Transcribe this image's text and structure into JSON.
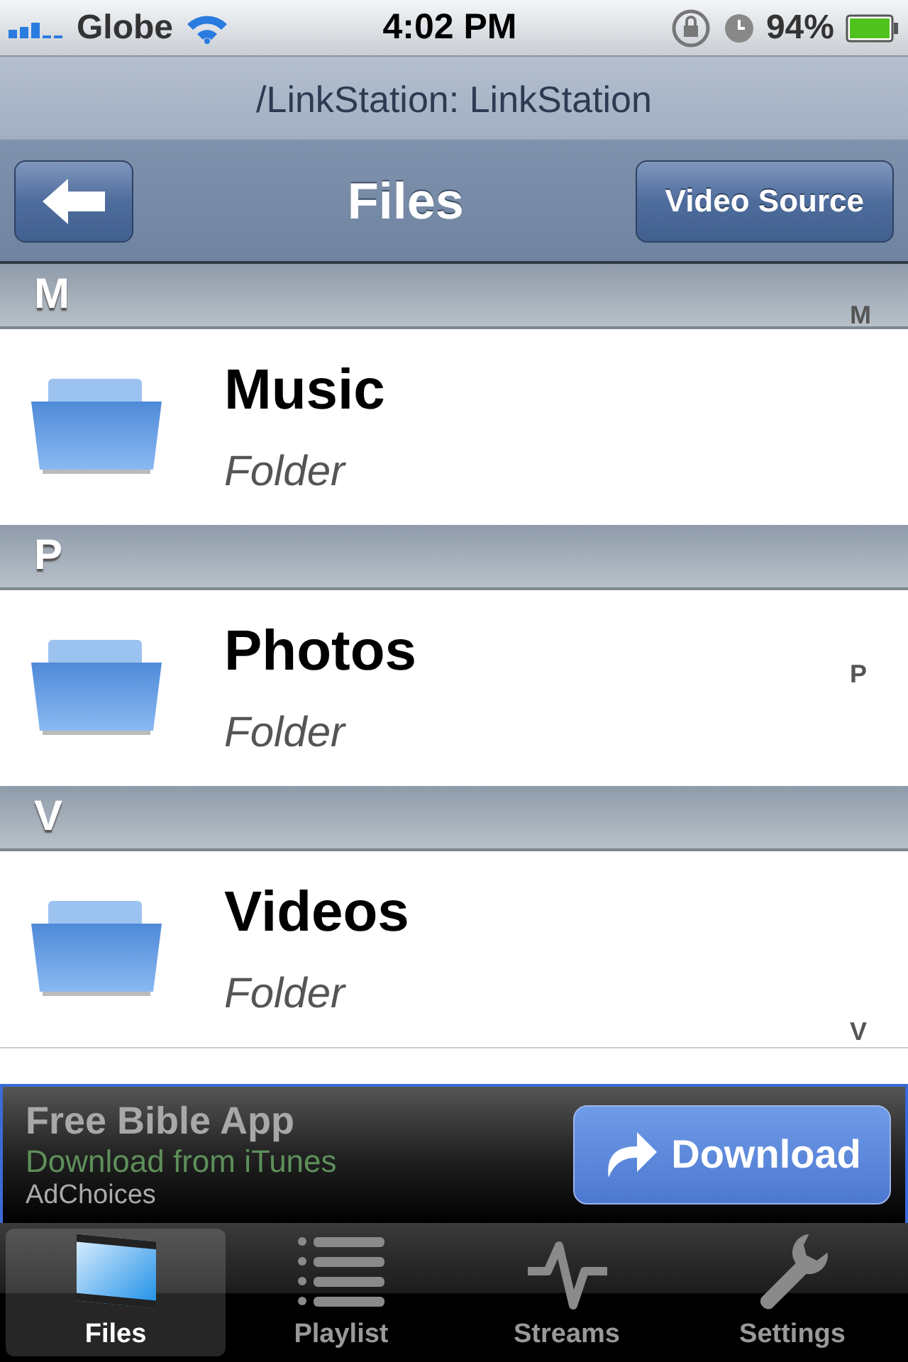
{
  "status_bar": {
    "carrier": "Globe",
    "time": "4:02 PM",
    "battery": "94%"
  },
  "nav": {
    "path": "/LinkStation: LinkStation",
    "title": "Files",
    "right_button": "Video Source"
  },
  "sections": [
    {
      "header": "M",
      "items": [
        {
          "name": "Music",
          "subtitle": "Folder"
        }
      ]
    },
    {
      "header": "P",
      "items": [
        {
          "name": "Photos",
          "subtitle": "Folder"
        }
      ]
    },
    {
      "header": "V",
      "items": [
        {
          "name": "Videos",
          "subtitle": "Folder"
        }
      ]
    }
  ],
  "index": [
    "M",
    "P",
    "V"
  ],
  "ad": {
    "title": "Free Bible App",
    "subtitle": "Download from iTunes",
    "choices": "AdChoices",
    "button": "Download"
  },
  "tabs": [
    {
      "label": "Files",
      "kind": "film",
      "selected": true
    },
    {
      "label": "Playlist",
      "kind": "list",
      "selected": false
    },
    {
      "label": "Streams",
      "kind": "pulse",
      "selected": false
    },
    {
      "label": "Settings",
      "kind": "wrench",
      "selected": false
    }
  ]
}
